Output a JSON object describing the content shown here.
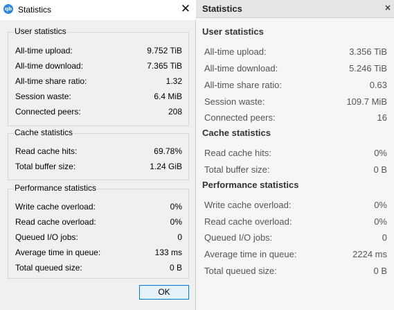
{
  "windows_dialog": {
    "app_icon_text": "qb",
    "title": "Statistics",
    "close_glyph": "✕",
    "user_group": {
      "title": "User statistics",
      "rows": [
        {
          "label": "All-time upload:",
          "value": "9.752 TiB"
        },
        {
          "label": "All-time download:",
          "value": "7.365 TiB"
        },
        {
          "label": "All-time share ratio:",
          "value": "1.32"
        },
        {
          "label": "Session waste:",
          "value": "6.4 MiB"
        },
        {
          "label": "Connected peers:",
          "value": "208"
        }
      ]
    },
    "cache_group": {
      "title": "Cache statistics",
      "rows": [
        {
          "label": "Read cache hits:",
          "value": "69.78%"
        },
        {
          "label": "Total buffer size:",
          "value": "1.24 GiB"
        }
      ]
    },
    "perf_group": {
      "title": "Performance statistics",
      "rows": [
        {
          "label": "Write cache overload:",
          "value": "0%"
        },
        {
          "label": "Read cache overload:",
          "value": "0%"
        },
        {
          "label": "Queued I/O jobs:",
          "value": "0"
        },
        {
          "label": "Average time in queue:",
          "value": "133 ms"
        },
        {
          "label": "Total queued size:",
          "value": "0 B"
        }
      ]
    },
    "ok_label": "OK"
  },
  "qt_dialog": {
    "title": "Statistics",
    "close_glyph": "×",
    "user_group": {
      "title": "User statistics",
      "rows": [
        {
          "label": "All-time upload:",
          "value": "3.356 TiB"
        },
        {
          "label": "All-time download:",
          "value": "5.246 TiB"
        },
        {
          "label": "All-time share ratio:",
          "value": "0.63"
        },
        {
          "label": "Session waste:",
          "value": "109.7 MiB"
        },
        {
          "label": "Connected peers:",
          "value": "16"
        }
      ]
    },
    "cache_group": {
      "title": "Cache statistics",
      "rows": [
        {
          "label": "Read cache hits:",
          "value": "0%"
        },
        {
          "label": "Total buffer size:",
          "value": "0 B"
        }
      ]
    },
    "perf_group": {
      "title": "Performance statistics",
      "rows": [
        {
          "label": "Write cache overload:",
          "value": "0%"
        },
        {
          "label": "Read cache overload:",
          "value": "0%"
        },
        {
          "label": "Queued I/O jobs:",
          "value": "0"
        },
        {
          "label": "Average time in queue:",
          "value": "2224 ms"
        },
        {
          "label": "Total queued size:",
          "value": "0 B"
        }
      ]
    }
  }
}
